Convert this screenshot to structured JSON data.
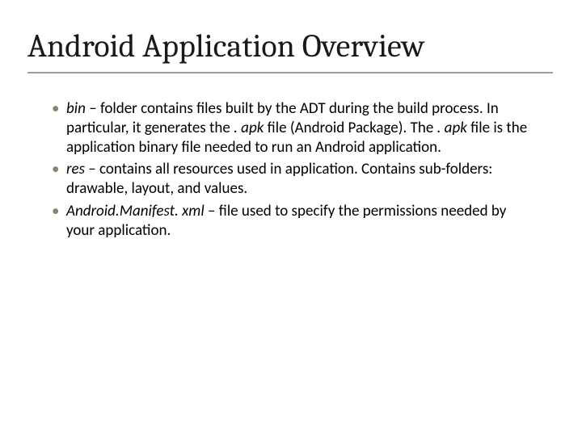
{
  "title": "Android Application Overview",
  "bullets": [
    {
      "term": "bin",
      "rest": " – folder contains files built by the ADT during the build process.  In particular, it generates the ",
      "term2": ". apk",
      "rest2": " file (Android Package).  The ",
      "term3": ". apk",
      "rest3": " file is the application binary file needed to run an Android application."
    },
    {
      "term": "res",
      "rest": " – contains all resources used in application.  Contains sub-folders:  drawable, layout, and values."
    },
    {
      "term": "Android.Manifest. xml",
      "rest": " – file used to specify the permissions needed by your application."
    }
  ]
}
